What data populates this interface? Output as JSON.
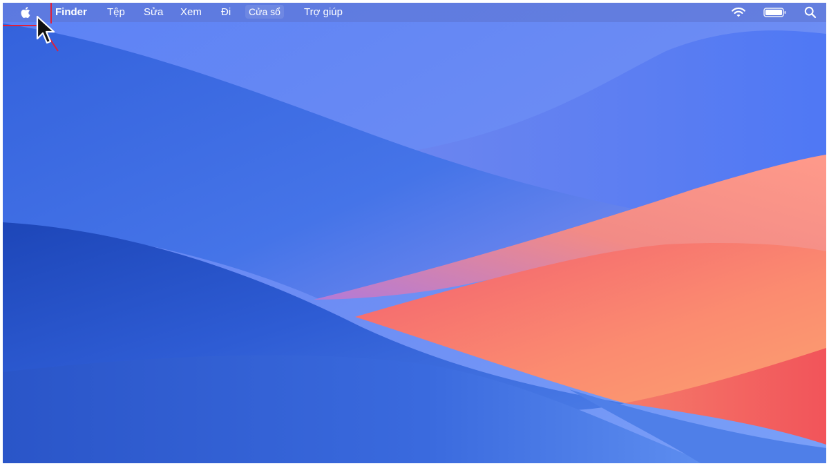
{
  "menubar": {
    "app_name": "Finder",
    "menus": [
      "Tệp",
      "Sửa",
      "Xem",
      "Đi",
      "Cửa sổ",
      "Trợ giúp"
    ],
    "apple_icon": "apple-logo-icon"
  },
  "status_bar": {
    "icons": [
      "wifi-icon",
      "battery-icon",
      "spotlight-search-icon"
    ]
  },
  "colors": {
    "menubar_bg": "#5c72cd",
    "wallpaper_blue": "#3f6fe6",
    "wallpaper_orange": "#f88a6a",
    "highlight_red": "#e0203a"
  }
}
